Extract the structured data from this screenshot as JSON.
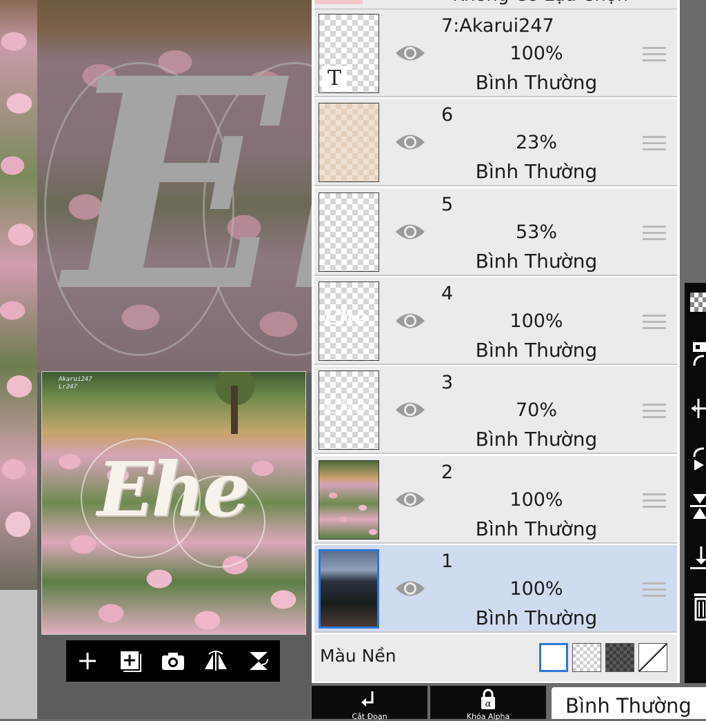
{
  "canvas": {
    "zoom_letters": "Eh",
    "preview_text": "Ehe",
    "watermark_line1": "Akarui247",
    "watermark_line2": "Lr247"
  },
  "canvas_toolbar": {
    "icons": [
      "plus-icon",
      "add-layer-icon",
      "camera-icon",
      "flip-icon",
      "merge-down-icon"
    ]
  },
  "layers_header_partial": "Không Có Lựa Chọn",
  "layers": [
    {
      "name": "7:Akarui247",
      "opacity": "100%",
      "mode": "Bình Thường",
      "thumb": "text",
      "thumb_text": "T",
      "visible": true,
      "selected": false
    },
    {
      "name": "6",
      "opacity": "23%",
      "mode": "Bình Thường",
      "thumb": "beige",
      "visible": true,
      "selected": false
    },
    {
      "name": "5",
      "opacity": "53%",
      "mode": "Bình Thường",
      "thumb": "empty",
      "visible": true,
      "selected": false
    },
    {
      "name": "4",
      "opacity": "100%",
      "mode": "Bình Thường",
      "thumb": "white-text",
      "thumb_text": "Ehe",
      "visible": true,
      "selected": false
    },
    {
      "name": "3",
      "opacity": "70%",
      "mode": "Bình Thường",
      "thumb": "faint-text",
      "thumb_text": "Ehe",
      "visible": true,
      "selected": false
    },
    {
      "name": "2",
      "opacity": "100%",
      "mode": "Bình Thường",
      "thumb": "tulips",
      "visible": true,
      "selected": false
    },
    {
      "name": "1",
      "opacity": "100%",
      "mode": "Bình Thường",
      "thumb": "sky",
      "visible": true,
      "selected": true
    }
  ],
  "background": {
    "label": "Màu Nền",
    "swatches": [
      "white",
      "transparent",
      "dark-checker",
      "none"
    ],
    "selected": "white"
  },
  "bottom_bar": {
    "clip_label": "Cắt Đoạn",
    "lock_label": "Khóa Alpha",
    "blend_mode": "Bình Thường"
  },
  "colors": {
    "selection_border": "#2f76d6",
    "selected_row": "#cfdbee",
    "row": "#ebebeb"
  }
}
